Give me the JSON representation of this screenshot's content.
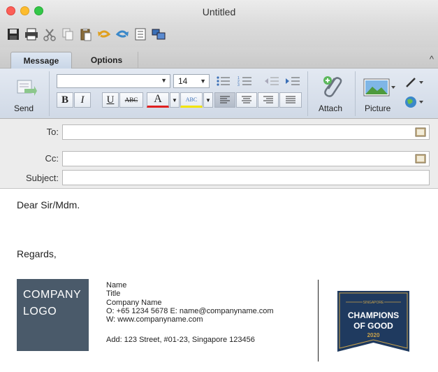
{
  "window": {
    "title": "Untitled"
  },
  "toolbar_icons": [
    "save-icon",
    "print-icon",
    "cut-icon",
    "copy-icon",
    "paste-icon",
    "undo-icon",
    "redo-icon",
    "checklist-icon",
    "windows-icon"
  ],
  "ribbon": {
    "tabs": [
      {
        "label": "Message",
        "active": true
      },
      {
        "label": "Options",
        "active": false
      }
    ],
    "send_label": "Send",
    "font_name": "",
    "font_size": "14",
    "format_buttons": {
      "bold": "B",
      "italic": "I",
      "underline": "U",
      "strike": "ABC",
      "font_color": "A",
      "highlight": "ABC"
    },
    "attach_label": "Attach",
    "picture_label": "Picture"
  },
  "fields": {
    "to_label": "To:",
    "cc_label": "Cc:",
    "subject_label": "Subject:",
    "to_value": "",
    "cc_value": "",
    "subject_value": ""
  },
  "body": {
    "greeting": "Dear Sir/Mdm.",
    "closing": "Regards,"
  },
  "signature": {
    "logo_line1": "COMPANY",
    "logo_line2": "LOGO",
    "name": "Name",
    "title": "Title",
    "company": "Company Name",
    "contact": "O: +65 1234 5678  E: name@companyname.com",
    "web": "W: www.companyname.com",
    "address": "Add: 123 Street, #01-23, Singapore 123456"
  },
  "badge": {
    "top": "SINGAPORE",
    "line1": "CHAMPIONS",
    "line2": "OF GOOD",
    "year": "2020"
  },
  "colors": {
    "ribbon_bg": "#d9e1ec",
    "logo_bg": "#4a5a6a",
    "badge_bg": "#1f3a5f",
    "badge_gold": "#c9a24a",
    "send_green": "#4caf50"
  }
}
